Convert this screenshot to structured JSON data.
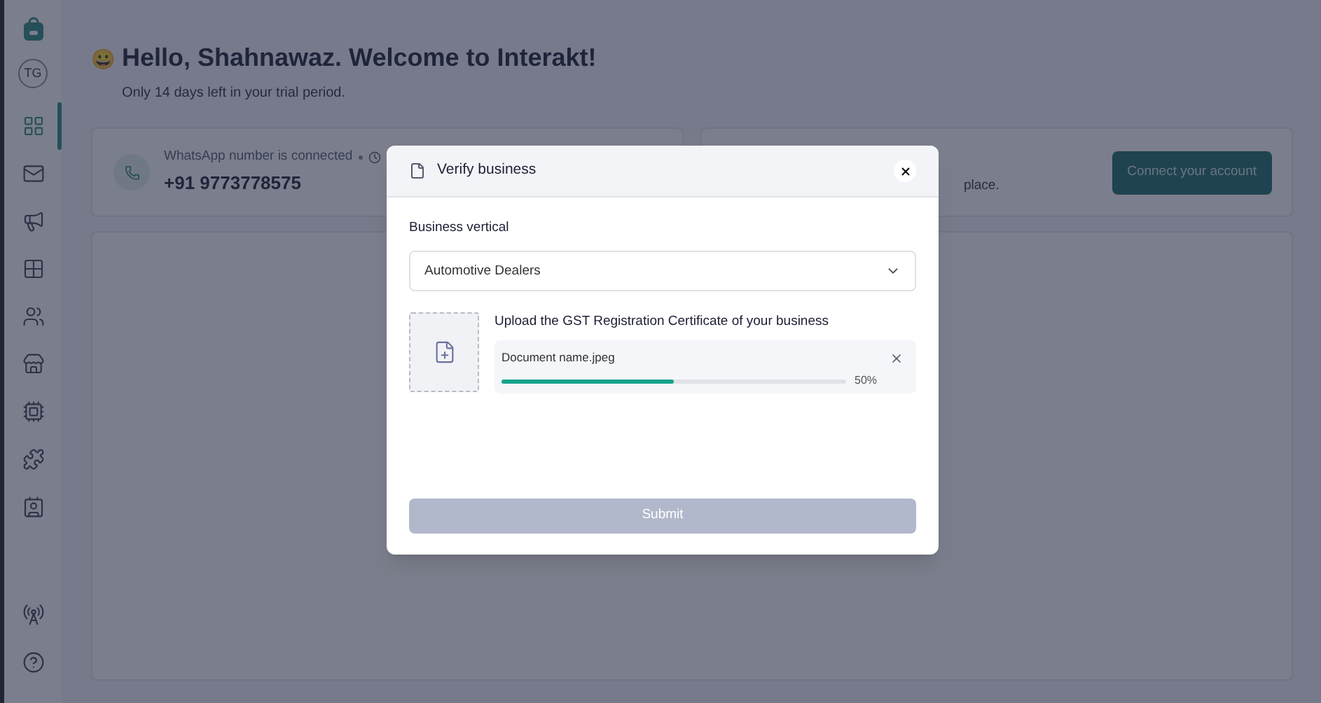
{
  "sidebar": {
    "avatar": "TG",
    "items": [
      {
        "kind": "dashboard",
        "selected": true
      },
      {
        "kind": "mail",
        "selected": false
      },
      {
        "kind": "megaphone",
        "selected": false
      },
      {
        "kind": "grid",
        "selected": false
      },
      {
        "kind": "users",
        "selected": false
      },
      {
        "kind": "store",
        "selected": false
      },
      {
        "kind": "chip",
        "selected": false
      },
      {
        "kind": "puzzle",
        "selected": false
      },
      {
        "kind": "contact",
        "selected": false
      }
    ],
    "bottom_items": [
      {
        "kind": "broadcast"
      },
      {
        "kind": "help"
      }
    ]
  },
  "header": {
    "emoji": "😀",
    "title": "Hello, Shahnawaz. Welcome to Interakt!",
    "subtitle": "Only 14 days left in your trial period."
  },
  "whatsapp_card": {
    "status": "WhatsApp number is connected",
    "phone": "+91 9773778575"
  },
  "instagram_card": {
    "description_tail": "place.",
    "button": "Connect your account"
  },
  "modal": {
    "title": "Verify business",
    "field_label": "Business vertical",
    "field_value": "Automotive Dealers",
    "upload_label": "Upload the GST Registration Certificate of your business",
    "file": {
      "name": "Document name.jpeg",
      "level": 0.5,
      "percent": "50%"
    },
    "submit": {
      "label": "Submit",
      "disabled": true
    }
  }
}
